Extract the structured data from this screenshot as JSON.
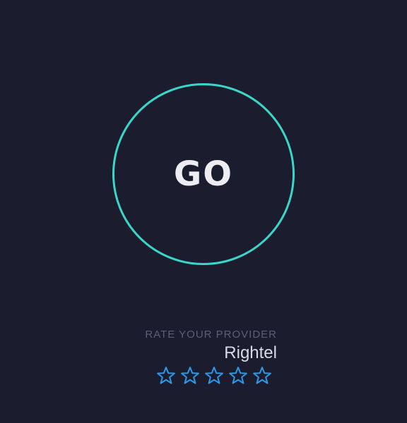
{
  "go_button": {
    "label": "GO"
  },
  "rating": {
    "heading": "RATE YOUR PROVIDER",
    "provider": "Rightel",
    "max_stars": 5,
    "value": 0,
    "star_icon": "star-outline-icon",
    "star_color": "#2b9ae8"
  },
  "colors": {
    "background": "#1b1d2f",
    "ring": "#3ad6c7",
    "text": "#ececf1",
    "muted": "#5c5f73"
  }
}
